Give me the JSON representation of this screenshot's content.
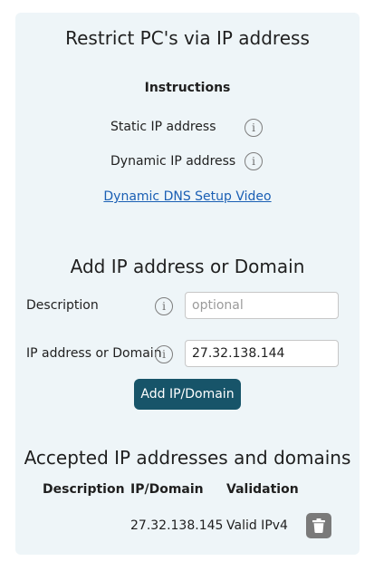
{
  "restrict_section": {
    "title": "Restrict PC's via IP address",
    "instructions_heading": "Instructions",
    "static_label": "Static IP address",
    "dynamic_label": "Dynamic IP address",
    "video_link": "Dynamic DNS Setup Video"
  },
  "add_section": {
    "title": "Add IP address or Domain",
    "description_label": "Description",
    "description_placeholder": "optional",
    "description_value": "",
    "ip_label": "IP address or Domain",
    "ip_value": "27.32.138.144",
    "add_button": "Add IP/Domain"
  },
  "accepted_section": {
    "title": "Accepted IP addresses and domains",
    "columns": [
      "Description",
      "IP/Domain",
      "Validation"
    ],
    "rows": [
      {
        "description": "",
        "ip": "27.32.138.145",
        "validation": "Valid IPv4"
      }
    ]
  },
  "icons": {
    "info": "info-icon",
    "delete": "trash-icon"
  },
  "colors": {
    "panel_bg": "#eef5f8",
    "primary_button": "#175469",
    "link": "#1a5fb4",
    "delete_button": "#7a7a7a"
  }
}
